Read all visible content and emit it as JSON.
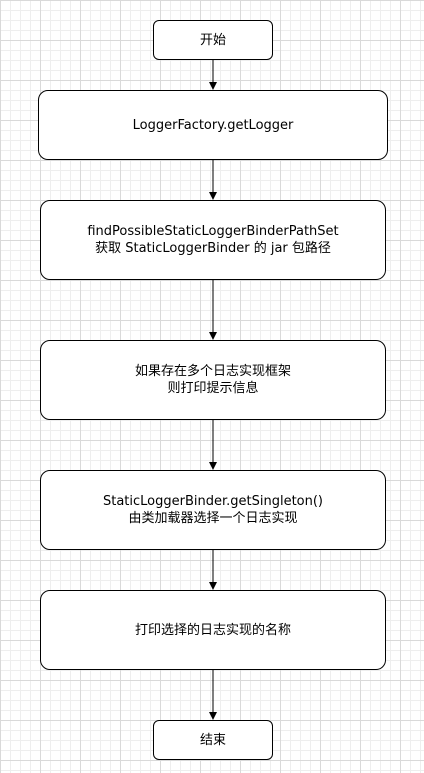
{
  "flowchart": {
    "start": {
      "text": "开始"
    },
    "steps": [
      {
        "lines": [
          "LoggerFactory.getLogger"
        ]
      },
      {
        "lines": [
          "findPossibleStaticLoggerBinderPathSet",
          "获取 StaticLoggerBinder 的 jar 包路径"
        ]
      },
      {
        "lines": [
          "如果存在多个日志实现框架",
          "则打印提示信息"
        ]
      },
      {
        "lines": [
          "StaticLoggerBinder.getSingleton()",
          "由类加载器选择一个日志实现"
        ]
      },
      {
        "lines": [
          "打印选择的日志实现的名称"
        ]
      }
    ],
    "end": {
      "text": "结束"
    }
  }
}
